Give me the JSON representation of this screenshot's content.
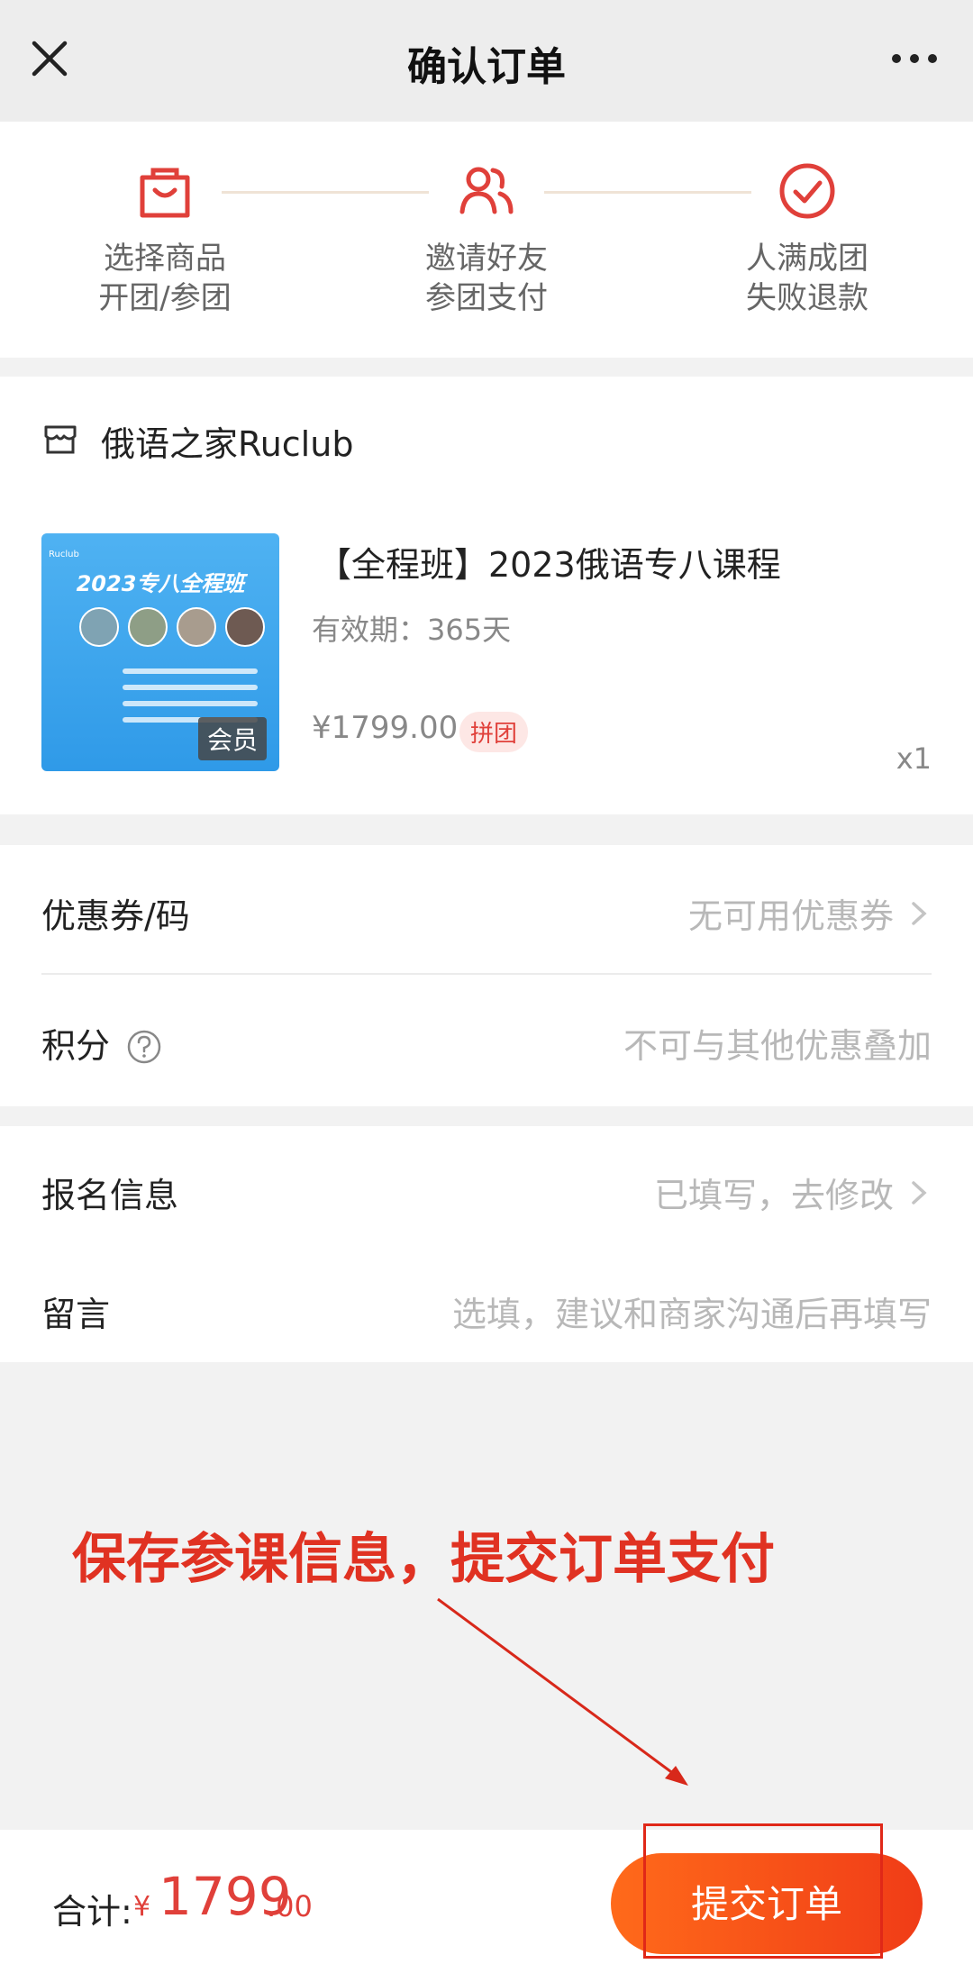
{
  "nav": {
    "title": "确认订单"
  },
  "steps": [
    {
      "line1": "选择商品",
      "line2": "开团/参团",
      "icon": "shopping-bag-icon"
    },
    {
      "line1": "邀请好友",
      "line2": "参团支付",
      "icon": "users-icon"
    },
    {
      "line1": "人满成团",
      "line2": "失败退款",
      "icon": "check-circle-icon"
    }
  ],
  "shop": {
    "name": "俄语之家Ruclub"
  },
  "product": {
    "title": "【全程班】2023俄语专八课程",
    "validity": "有效期：365天",
    "price": "¥1799.00",
    "tag": "拼团",
    "qty": "x1",
    "thumb_title": "2023专八全程班",
    "thumb_badge": "会员"
  },
  "coupon": {
    "label": "优惠券/码",
    "value": "无可用优惠券"
  },
  "points": {
    "label": "积分",
    "value": "不可与其他优惠叠加"
  },
  "signup": {
    "label": "报名信息",
    "value": "已填写，去修改"
  },
  "message": {
    "label": "留言",
    "placeholder": "选填，建议和商家沟通后再填写"
  },
  "annotation": "保存参课信息，提交订单支付",
  "footer": {
    "total_label": "合计:",
    "currency": "¥",
    "amount_int": "1799",
    "amount_dec": ".00",
    "submit_label": "提交订单"
  },
  "colors": {
    "accent": "#e0403a",
    "submit_start": "#ff6a1a",
    "submit_end": "#f03c17",
    "annotation": "#e03222"
  }
}
